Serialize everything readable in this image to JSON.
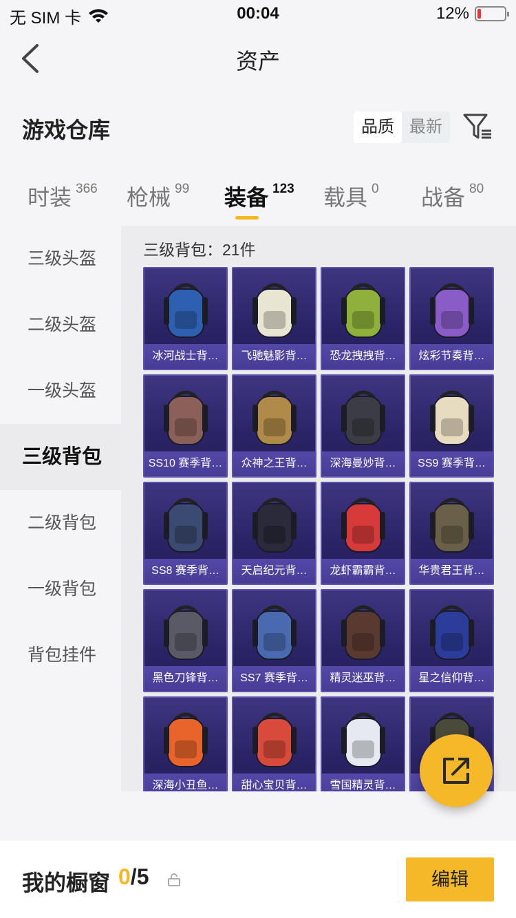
{
  "status_bar": {
    "carrier": "无 SIM 卡",
    "time": "00:04",
    "battery": "12%",
    "battery_level": 0.12
  },
  "nav": {
    "title": "资产"
  },
  "warehouse": {
    "title": "游戏仓库",
    "sort_options": [
      "品质",
      "最新"
    ]
  },
  "tabs": [
    {
      "label": "时装",
      "count": "366"
    },
    {
      "label": "枪械",
      "count": "99"
    },
    {
      "label": "装备",
      "count": "123"
    },
    {
      "label": "载具",
      "count": "0"
    },
    {
      "label": "战备",
      "count": "80"
    }
  ],
  "sidebar": [
    "三级头盔",
    "二级头盔",
    "一级头盔",
    "三级背包",
    "二级背包",
    "一级背包",
    "背包挂件"
  ],
  "content": {
    "count_line": "三级背包：21件",
    "items": [
      {
        "name": "冰河战士背…",
        "color": "#2f5fb0"
      },
      {
        "name": "飞驰魅影背…",
        "color": "#e8e6d2"
      },
      {
        "name": "恐龙拽拽背…",
        "color": "#8fb03a"
      },
      {
        "name": "炫彩节奏背…",
        "color": "#8a5cc8"
      },
      {
        "name": "SS10 赛季背…",
        "color": "#8a6058"
      },
      {
        "name": "众神之王背…",
        "color": "#b08a48"
      },
      {
        "name": "深海曼妙背…",
        "color": "#3c3c44"
      },
      {
        "name": "SS9 赛季背…",
        "color": "#e8dcc0"
      },
      {
        "name": "SS8 赛季背…",
        "color": "#3a4a70"
      },
      {
        "name": "天启纪元背…",
        "color": "#2a2a3a"
      },
      {
        "name": "龙虾霸霸背…",
        "color": "#d83a3a"
      },
      {
        "name": "华贵君王背…",
        "color": "#6a6048"
      },
      {
        "name": "黑色刀锋背…",
        "color": "#5a5a66"
      },
      {
        "name": "SS7 赛季背…",
        "color": "#4a6ab0"
      },
      {
        "name": "精灵迷巫背…",
        "color": "#5a3a30"
      },
      {
        "name": "星之信仰背…",
        "color": "#2c3c9a"
      },
      {
        "name": "深海小丑鱼…",
        "color": "#e8642a"
      },
      {
        "name": "甜心宝贝背…",
        "color": "#d84a3a"
      },
      {
        "name": "雪国精灵背…",
        "color": "#e6eaf0"
      },
      {
        "name": "…",
        "color": "#4a4a3a"
      }
    ]
  },
  "bottom": {
    "title": "我的橱窗",
    "current": "0",
    "total": "/5",
    "edit_label": "编辑"
  },
  "accent": "#f5b829"
}
